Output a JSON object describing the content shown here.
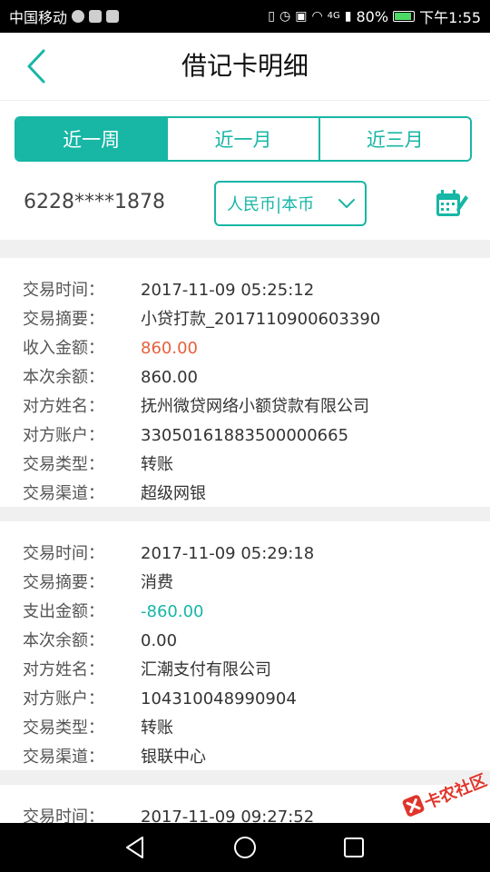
{
  "status_bar": {
    "carrier": "中国移动",
    "signal_type": "4G",
    "battery": "80%",
    "time": "下午1:55"
  },
  "header": {
    "title": "借记卡明细"
  },
  "tabs": [
    {
      "label": "近一周",
      "active": true
    },
    {
      "label": "近一月",
      "active": false
    },
    {
      "label": "近三月",
      "active": false
    }
  ],
  "account": {
    "number": "6228****1878",
    "currency": "人民币|本币"
  },
  "transactions": [
    {
      "rows": [
        {
          "key": "交易时间：",
          "value": "2017-11-09 05:25:12"
        },
        {
          "key": "交易摘要：",
          "value": "小贷打款_2017110900603390"
        },
        {
          "key": "收入金额：",
          "value": "860.00",
          "tone": "income"
        },
        {
          "key": "本次余额：",
          "value": "860.00"
        },
        {
          "key": "对方姓名：",
          "value": "抚州微贷网络小额贷款有限公司"
        },
        {
          "key": "对方账户：",
          "value": "33050161883500000665"
        },
        {
          "key": "交易类型：",
          "value": "转账"
        },
        {
          "key": "交易渠道：",
          "value": "超级网银"
        }
      ]
    },
    {
      "rows": [
        {
          "key": "交易时间：",
          "value": "2017-11-09 05:29:18"
        },
        {
          "key": "交易摘要：",
          "value": "消费"
        },
        {
          "key": "支出金额：",
          "value": "-860.00",
          "tone": "expense"
        },
        {
          "key": "本次余额：",
          "value": "0.00"
        },
        {
          "key": "对方姓名：",
          "value": "汇潮支付有限公司"
        },
        {
          "key": "对方账户：",
          "value": "104310048990904"
        },
        {
          "key": "交易类型：",
          "value": "转账"
        },
        {
          "key": "交易渠道：",
          "value": "银联中心"
        }
      ]
    },
    {
      "rows": [
        {
          "key": "交易时间：",
          "value": "2017-11-09 09:27:52"
        }
      ]
    }
  ],
  "watermark": {
    "text": "卡农社区"
  },
  "colors": {
    "accent": "#17b6a5",
    "income": "#e8603c",
    "separator": "#f0f0f0"
  }
}
